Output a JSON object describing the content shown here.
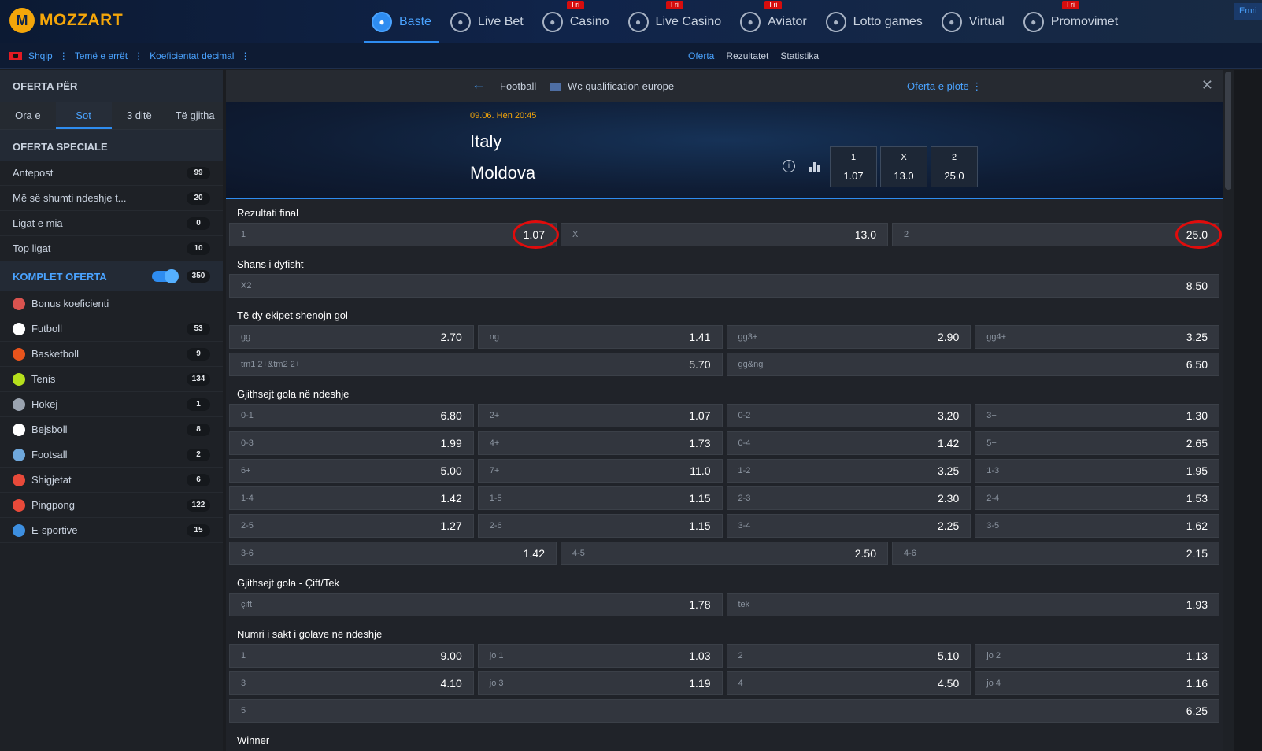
{
  "brand": {
    "name": "MOZZART"
  },
  "nav": [
    {
      "label": "Baste",
      "icon": "soccer-ball-icon",
      "badge": "",
      "active": true
    },
    {
      "label": "Live Bet",
      "icon": "live-bet-icon",
      "badge": ""
    },
    {
      "label": "Casino",
      "icon": "cherries-icon",
      "badge": "I ri"
    },
    {
      "label": "Live Casino",
      "icon": "live-casino-icon",
      "badge": "I ri"
    },
    {
      "label": "Aviator",
      "icon": "airplane-icon",
      "badge": "I ri"
    },
    {
      "label": "Lotto games",
      "icon": "lotto-icon",
      "badge": ""
    },
    {
      "label": "Virtual",
      "icon": "virtual-icon",
      "badge": ""
    },
    {
      "label": "Promovimet",
      "icon": "megaphone-icon",
      "badge": "I ri"
    }
  ],
  "account": {
    "label": "Emri"
  },
  "subbar": {
    "language": "Shqip",
    "theme": "Temë e errët",
    "odds_format": "Koeficientat decimal",
    "tabs": [
      "Oferta",
      "Rezultatet",
      "Statistika"
    ]
  },
  "sidebar": {
    "offer_for": "OFERTA PËR",
    "time_tabs": [
      "Ora e",
      "Sot",
      "3 ditë",
      "Të gjitha"
    ],
    "special_title": "OFERTA SPECIALE",
    "special_items": [
      {
        "label": "Antepost",
        "count": "99"
      },
      {
        "label": "Më së shumti ndeshje t...",
        "count": "20"
      },
      {
        "label": "Ligat e mia",
        "count": "0"
      },
      {
        "label": "Top ligat",
        "count": "10"
      }
    ],
    "komplet_label": "KOMPLET OFERTA",
    "komplet_count": "350",
    "sports": [
      {
        "label": "Bonus koeficienti",
        "count": "",
        "color": "#d9534f"
      },
      {
        "label": "Futboll",
        "count": "53",
        "color": "#ffffff"
      },
      {
        "label": "Basketboll",
        "count": "9",
        "color": "#e8541c"
      },
      {
        "label": "Tenis",
        "count": "134",
        "color": "#b6e01c"
      },
      {
        "label": "Hokej",
        "count": "1",
        "color": "#9aa3af"
      },
      {
        "label": "Bejsboll",
        "count": "8",
        "color": "#ffffff"
      },
      {
        "label": "Footsall",
        "count": "2",
        "color": "#6fa8dc"
      },
      {
        "label": "Shigjetat",
        "count": "6",
        "color": "#e84a3a"
      },
      {
        "label": "Pingpong",
        "count": "122",
        "color": "#e84a3a"
      },
      {
        "label": "E-sportive",
        "count": "15",
        "color": "#3d8fe0"
      }
    ]
  },
  "match": {
    "sport": "Football",
    "competition": "Wc qualification europe",
    "full_offer": "Oferta e plotë",
    "datetime": "09.06. Hen 20:45",
    "home": "Italy",
    "away": "Moldova",
    "quick_odds": [
      {
        "key": "1",
        "odd": "1.07"
      },
      {
        "key": "X",
        "odd": "13.0"
      },
      {
        "key": "2",
        "odd": "25.0"
      }
    ]
  },
  "markets": [
    {
      "title": "Rezultati final",
      "rows": [
        [
          {
            "label": "1",
            "odd": "1.07",
            "circled": true
          },
          {
            "label": "X",
            "odd": "13.0"
          },
          {
            "label": "2",
            "odd": "25.0",
            "circled": true
          }
        ]
      ]
    },
    {
      "title": "Shans i dyfisht",
      "rows": [
        [
          {
            "label": "X2",
            "odd": "8.50"
          }
        ]
      ]
    },
    {
      "title": "Të dy ekipet shenojn gol",
      "rows": [
        [
          {
            "label": "gg",
            "odd": "2.70"
          },
          {
            "label": "ng",
            "odd": "1.41"
          },
          {
            "label": "gg3+",
            "odd": "2.90"
          },
          {
            "label": "gg4+",
            "odd": "3.25"
          }
        ],
        [
          {
            "label": "tm1 2+&tm2 2+",
            "odd": "5.70"
          },
          {
            "label": "gg&ng",
            "odd": "6.50"
          }
        ]
      ]
    },
    {
      "title": "Gjithsejt gola në ndeshje",
      "rows": [
        [
          {
            "label": "0-1",
            "odd": "6.80"
          },
          {
            "label": "2+",
            "odd": "1.07"
          },
          {
            "label": "0-2",
            "odd": "3.20"
          },
          {
            "label": "3+",
            "odd": "1.30"
          }
        ],
        [
          {
            "label": "0-3",
            "odd": "1.99"
          },
          {
            "label": "4+",
            "odd": "1.73"
          },
          {
            "label": "0-4",
            "odd": "1.42"
          },
          {
            "label": "5+",
            "odd": "2.65"
          }
        ],
        [
          {
            "label": "6+",
            "odd": "5.00"
          },
          {
            "label": "7+",
            "odd": "11.0"
          },
          {
            "label": "1-2",
            "odd": "3.25"
          },
          {
            "label": "1-3",
            "odd": "1.95"
          }
        ],
        [
          {
            "label": "1-4",
            "odd": "1.42"
          },
          {
            "label": "1-5",
            "odd": "1.15"
          },
          {
            "label": "2-3",
            "odd": "2.30"
          },
          {
            "label": "2-4",
            "odd": "1.53"
          }
        ],
        [
          {
            "label": "2-5",
            "odd": "1.27"
          },
          {
            "label": "2-6",
            "odd": "1.15"
          },
          {
            "label": "3-4",
            "odd": "2.25"
          },
          {
            "label": "3-5",
            "odd": "1.62"
          }
        ],
        [
          {
            "label": "3-6",
            "odd": "1.42"
          },
          {
            "label": "4-5",
            "odd": "2.50"
          },
          {
            "label": "4-6",
            "odd": "2.15"
          }
        ]
      ]
    },
    {
      "title": "Gjithsejt gola - Çift/Tek",
      "rows": [
        [
          {
            "label": "çift",
            "odd": "1.78"
          },
          {
            "label": "tek",
            "odd": "1.93"
          }
        ]
      ]
    },
    {
      "title": "Numri i sakt i golave në ndeshje",
      "rows": [
        [
          {
            "label": "1",
            "odd": "9.00"
          },
          {
            "label": "jo 1",
            "odd": "1.03"
          },
          {
            "label": "2",
            "odd": "5.10"
          },
          {
            "label": "jo 2",
            "odd": "1.13"
          }
        ],
        [
          {
            "label": "3",
            "odd": "4.10"
          },
          {
            "label": "jo 3",
            "odd": "1.19"
          },
          {
            "label": "4",
            "odd": "4.50"
          },
          {
            "label": "jo 4",
            "odd": "1.16"
          }
        ],
        [
          {
            "label": "5",
            "odd": "6.25"
          }
        ]
      ]
    },
    {
      "title": "Winner",
      "rows": []
    }
  ]
}
